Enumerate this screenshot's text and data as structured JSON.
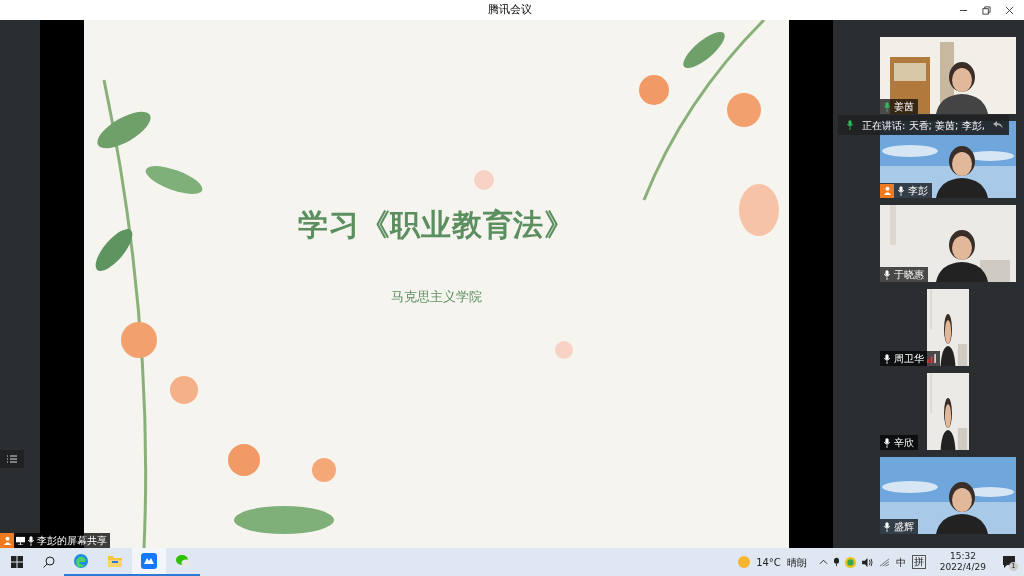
{
  "window": {
    "title": "腾讯会议"
  },
  "slide": {
    "title": "学习《职业教育法》",
    "subtitle": "马克思主义学院"
  },
  "speaking": {
    "text": "正在讲话: 天香; 姜茵; 李彭,"
  },
  "participants": [
    {
      "name": "姜茵",
      "kind": "landscape",
      "host": false,
      "speaking": true,
      "signal": false
    },
    {
      "name": "李彭",
      "kind": "landscape",
      "host": true,
      "speaking": false,
      "signal": false
    },
    {
      "name": "于晓惠",
      "kind": "landscape",
      "host": false,
      "speaking": false,
      "signal": false
    },
    {
      "name": "周卫华",
      "kind": "portrait",
      "host": false,
      "speaking": false,
      "signal": true
    },
    {
      "name": "辛欣",
      "kind": "portrait",
      "host": false,
      "speaking": false,
      "signal": false
    },
    {
      "name": "盛辉",
      "kind": "landscape",
      "host": false,
      "speaking": false,
      "signal": false
    }
  ],
  "share_label": "李彭的屏幕共享",
  "taskbar": {
    "apps": [
      {
        "kind": "browser",
        "active": false
      },
      {
        "kind": "folder",
        "active": false
      },
      {
        "kind": "meeting",
        "active": true
      },
      {
        "kind": "chat",
        "active": false
      }
    ],
    "temperature": "14°C",
    "weather": "晴朗",
    "ime": "中",
    "ime_mode": "拼",
    "time": "15:32",
    "date": "2022/4/29",
    "notifications": "1"
  }
}
